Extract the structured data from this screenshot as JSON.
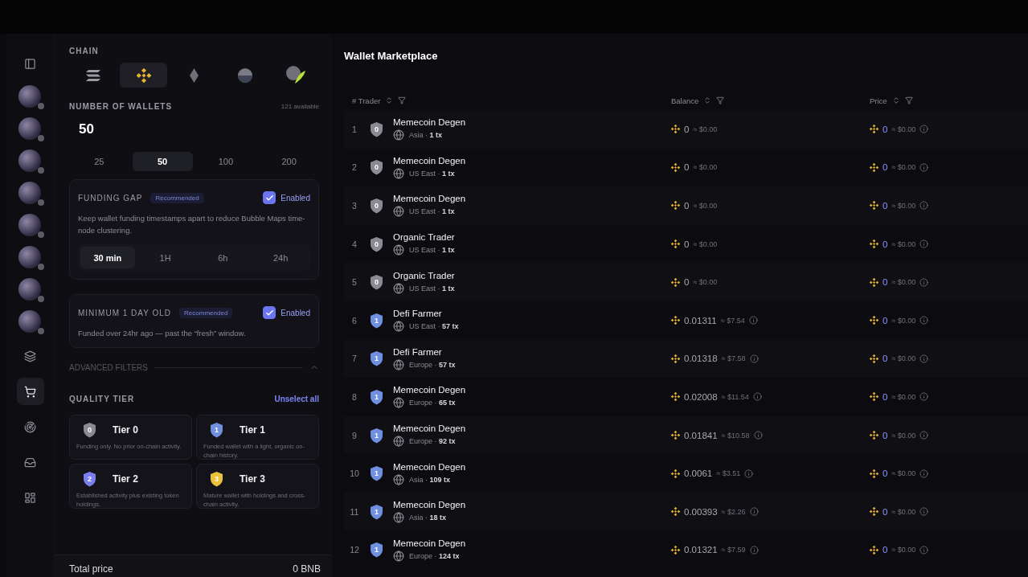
{
  "rail": {
    "avatars": [
      {
        "online": false
      },
      {
        "online": false
      },
      {
        "online": false
      },
      {
        "online": false
      },
      {
        "online": false
      },
      {
        "online": false
      },
      {
        "online": false
      },
      {
        "online": false
      }
    ],
    "tools": [
      {
        "kind": "cards",
        "selected": false
      },
      {
        "kind": "cart",
        "selected": true
      },
      {
        "kind": "radar",
        "selected": false
      },
      {
        "kind": "inbox",
        "selected": false
      },
      {
        "kind": "dashboard",
        "selected": false
      }
    ]
  },
  "sidebar": {
    "chain_label": "CHAIN",
    "chains": [
      {
        "kind": "solana",
        "selected": false
      },
      {
        "kind": "bnb",
        "selected": true
      },
      {
        "kind": "ethereum",
        "selected": false
      },
      {
        "kind": "orb",
        "selected": false
      },
      {
        "kind": "feather",
        "selected": false
      }
    ],
    "wallets_label": "NUMBER OF WALLETS",
    "available": "121 available",
    "wallets_value": "50",
    "wallet_options": [
      {
        "label": "25",
        "selected": false
      },
      {
        "label": "50",
        "selected": true
      },
      {
        "label": "100",
        "selected": false
      },
      {
        "label": "200",
        "selected": false
      }
    ],
    "filters": [
      {
        "title": "FUNDING GAP",
        "badge": "Recommended",
        "checked": true,
        "status": "Enabled",
        "description": "Keep wallet funding timestamps apart to reduce Bubble Maps time-node clustering.",
        "options": [
          {
            "label": "30 min",
            "selected": true
          },
          {
            "label": "1H",
            "selected": false
          },
          {
            "label": "6h",
            "selected": false
          },
          {
            "label": "24h",
            "selected": false
          }
        ]
      },
      {
        "title": "MINIMUM 1 DAY OLD",
        "badge": "Recommended",
        "checked": true,
        "status": "Enabled",
        "description": "Funded over 24hr ago — past the “fresh” window."
      }
    ],
    "advanced": {
      "label": "ADVANCED FILTERS",
      "expanded": true
    },
    "quality": {
      "label": "QUALITY TIER",
      "action": "Unselect all",
      "tiers": [
        {
          "title": "Tier 0",
          "tier": "0",
          "color": "#8a8a92",
          "description": "Funding only. No prior on-chain activity."
        },
        {
          "title": "Tier 1",
          "tier": "1",
          "color": "#6f8fe0",
          "description": "Funded wallet with a light, organic on-chain history."
        },
        {
          "title": "Tier 2",
          "tier": "2",
          "color": "#7a7ff0",
          "description": "Established activity plus existing token holdings."
        },
        {
          "title": "Tier 3",
          "tier": "3",
          "color": "#e9c13a",
          "description": "Mature wallet with holdings and cross-chain activity."
        }
      ]
    },
    "total_label": "Total price",
    "total_value": "0 BNB"
  },
  "main": {
    "title": "Wallet Marketplace",
    "columns": [
      {
        "label": "# Trader"
      },
      {
        "label": "Balance"
      },
      {
        "label": "Price"
      }
    ],
    "rows": [
      {
        "index": "1",
        "tier": "0",
        "color": "#8a8a92",
        "name": "Memecoin Degen",
        "meta": "Asia · **1 tx**",
        "balance": "0",
        "balance_usd": "≈ $0.00",
        "balance_info": false,
        "price": "0",
        "price_usd": "≈ $0.00"
      },
      {
        "index": "2",
        "tier": "0",
        "color": "#8a8a92",
        "name": "Memecoin Degen",
        "meta": "US East · **1 tx**",
        "balance": "0",
        "balance_usd": "≈ $0.00",
        "balance_info": false,
        "price": "0",
        "price_usd": "≈ $0.00"
      },
      {
        "index": "3",
        "tier": "0",
        "color": "#8a8a92",
        "name": "Memecoin Degen",
        "meta": "US East · **1 tx**",
        "balance": "0",
        "balance_usd": "≈ $0.00",
        "balance_info": false,
        "price": "0",
        "price_usd": "≈ $0.00"
      },
      {
        "index": "4",
        "tier": "0",
        "color": "#8a8a92",
        "name": "Organic Trader",
        "meta": "US East · **1 tx**",
        "balance": "0",
        "balance_usd": "≈ $0.00",
        "balance_info": false,
        "price": "0",
        "price_usd": "≈ $0.00"
      },
      {
        "index": "5",
        "tier": "0",
        "color": "#8a8a92",
        "name": "Organic Trader",
        "meta": "US East · **1 tx**",
        "balance": "0",
        "balance_usd": "≈ $0.00",
        "balance_info": false,
        "price": "0",
        "price_usd": "≈ $0.00"
      },
      {
        "index": "6",
        "tier": "1",
        "color": "#6f8fe0",
        "name": "Defi Farmer",
        "meta": "US East · **57 tx**",
        "balance": "0.01311",
        "balance_usd": "≈ $7.54",
        "balance_info": true,
        "price": "0",
        "price_usd": "≈ $0.00"
      },
      {
        "index": "7",
        "tier": "1",
        "color": "#6f8fe0",
        "name": "Defi Farmer",
        "meta": "Europe · **57 tx**",
        "balance": "0.01318",
        "balance_usd": "≈ $7.58",
        "balance_info": true,
        "price": "0",
        "price_usd": "≈ $0.00"
      },
      {
        "index": "8",
        "tier": "1",
        "color": "#6f8fe0",
        "name": "Memecoin Degen",
        "meta": "Europe · **65 tx**",
        "balance": "0.02008",
        "balance_usd": "≈ $11.54",
        "balance_info": true,
        "price": "0",
        "price_usd": "≈ $0.00"
      },
      {
        "index": "9",
        "tier": "1",
        "color": "#6f8fe0",
        "name": "Memecoin Degen",
        "meta": "Europe · **92 tx**",
        "balance": "0.01841",
        "balance_usd": "≈ $10.58",
        "balance_info": true,
        "price": "0",
        "price_usd": "≈ $0.00"
      },
      {
        "index": "10",
        "tier": "1",
        "color": "#6f8fe0",
        "name": "Memecoin Degen",
        "meta": "Asia · **109 tx**",
        "balance": "0.0061",
        "balance_usd": "≈ $3.51",
        "balance_info": true,
        "price": "0",
        "price_usd": "≈ $0.00"
      },
      {
        "index": "11",
        "tier": "1",
        "color": "#6f8fe0",
        "name": "Memecoin Degen",
        "meta": "Asia · **18 tx**",
        "balance": "0.00393",
        "balance_usd": "≈ $2.26",
        "balance_info": true,
        "price": "0",
        "price_usd": "≈ $0.00"
      },
      {
        "index": "12",
        "tier": "1",
        "color": "#6f8fe0",
        "name": "Memecoin Degen",
        "meta": "Europe · **124 tx**",
        "balance": "0.01321",
        "balance_usd": "≈ $7.59",
        "balance_info": true,
        "price": "0",
        "price_usd": "≈ $0.00"
      }
    ]
  }
}
